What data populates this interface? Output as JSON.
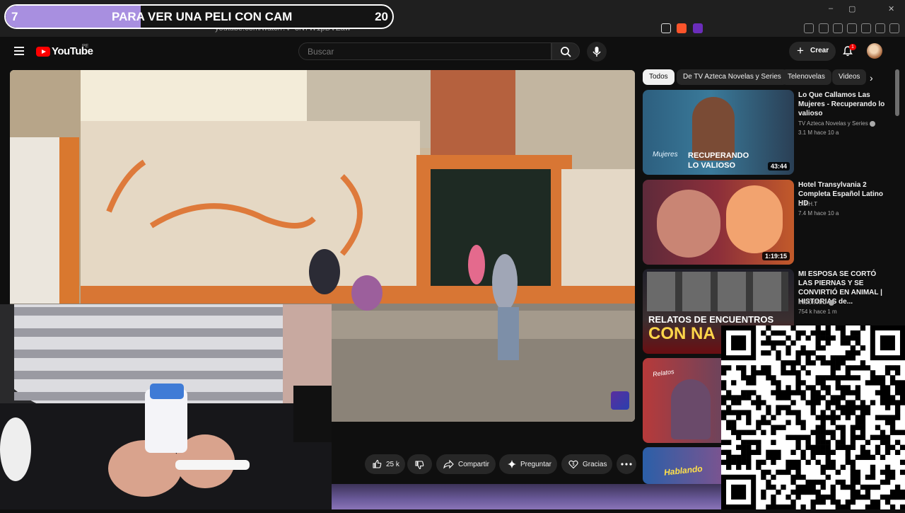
{
  "browser": {
    "url": "youtube.com/watch?v=3N7W1pDVZaw",
    "window_controls": [
      "–",
      "▢",
      "✕"
    ]
  },
  "stream_banner": {
    "left_number": "7",
    "title": "PARA VER UNA PELI CON CAM",
    "right_number": "20",
    "progress_fraction": 0.35,
    "progress_color": "#a88fe0"
  },
  "header": {
    "logo_text": "YouTube",
    "region": "PE",
    "search_placeholder": "Buscar",
    "create_label": "Crear",
    "notification_count": "1"
  },
  "actions": {
    "like_count": "25 k",
    "share_label": "Compartir",
    "ask_label": "Preguntar",
    "thanks_label": "Gracias"
  },
  "chips": [
    "Todos",
    "De TV Azteca Novelas y Series",
    "Telenovelas",
    "Videos"
  ],
  "recommendations": [
    {
      "title": "Lo Que Callamos Las Mujeres - Recuperando lo valioso",
      "channel": "TV Azteca Novelas y Series",
      "verified": true,
      "meta": "3.1 M  hace 10 a",
      "duration": "43:44",
      "thumb_overlay_script": "Mujeres",
      "thumb_overlay_line1": "RECUPERANDO",
      "thumb_overlay_line2": "LO VALIOSO"
    },
    {
      "title": "Hotel Transylvania 2 Completa Español Latino HD",
      "channel": "D.J.H.T",
      "verified": false,
      "meta": "7.4 M  hace 10 a",
      "duration": "1:19:15"
    },
    {
      "title": "MI ESPOSA SE CORTÓ LAS PIERNAS Y SE CONVIRTIÓ EN ANIMAL | HISTORIAS de...",
      "channel": "INSOMNIO",
      "verified": true,
      "meta": "754 k  hace 1 m",
      "thumb_overlay_line1": "RELATOS DE ENCUENTROS",
      "thumb_overlay_line2": "CON NA"
    },
    {
      "thumb_overlay_line1": "Relatos"
    },
    {
      "thumb_overlay_line1": "Hablando"
    }
  ],
  "colors": {
    "accent": "#ff0000",
    "background": "#0f0f0f",
    "chip_bg": "#272727"
  }
}
